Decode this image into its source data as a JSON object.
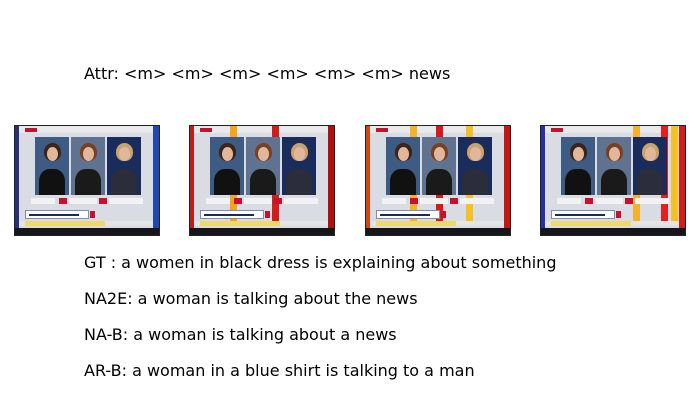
{
  "attr_line": "Attr: <m> <m> <m> <m> <m> <m> news",
  "frames": [
    {
      "edge_left": "#2a2f7a",
      "edge_right": "#2047b8",
      "stripes": []
    },
    {
      "edge_left": "#c21d1d",
      "edge_right": "#b01010",
      "stripes": [
        "#f4a31f",
        "#d21d1d"
      ]
    },
    {
      "edge_left": "#d54411",
      "edge_right": "#c81414",
      "stripes": [
        "#f6b12a",
        "#d61a1a",
        "#f4c028"
      ]
    },
    {
      "edge_left": "#2831a4",
      "edge_right": "#d41b1b",
      "stripes": [
        "#f5b02c",
        "#e22020",
        "#f4c028"
      ]
    }
  ],
  "captions": {
    "gt": "GT  : a women in black dress is explaining about something",
    "na2e": "NA2E: a woman is talking about the news",
    "nab": "NA-B: a woman is talking about a news",
    "arb": "AR-B: a woman in a blue shirt is talking to a man"
  }
}
